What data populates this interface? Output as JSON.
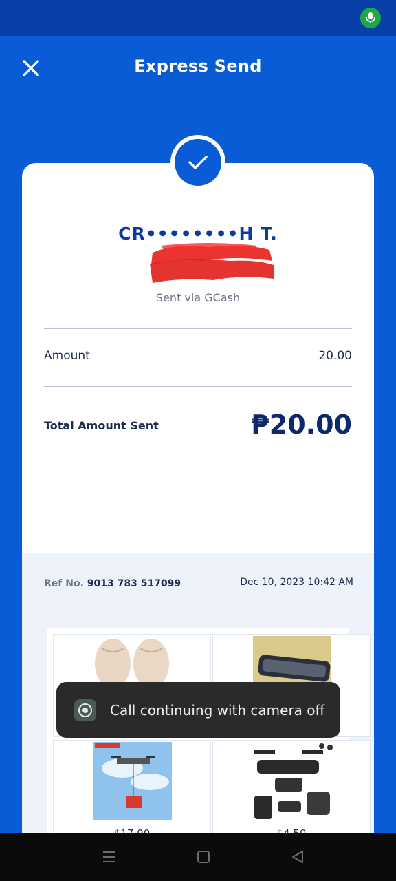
{
  "header": {
    "title": "Express Send"
  },
  "recipient": {
    "name": "CR••••••••H T.",
    "sent_via": "Sent via GCash"
  },
  "amount": {
    "label": "Amount",
    "value": "20.00"
  },
  "total": {
    "label": "Total Amount Sent",
    "value": "₱20.00"
  },
  "reference": {
    "label": "Ref No.",
    "number": "9013 783 517099",
    "datetime": "Dec 10, 2023 10:42 AM"
  },
  "ads": [
    {
      "price": ""
    },
    {
      "price": ""
    },
    {
      "price": "$17.00"
    },
    {
      "price": "$4.50"
    }
  ],
  "toast": {
    "text": "Call continuing with camera off"
  },
  "icons": {
    "close": "close-icon",
    "check": "check-icon",
    "mic": "microphone-icon",
    "camera": "camera-off-icon",
    "nav_menu": "menu-icon",
    "nav_home": "home-icon",
    "nav_back": "back-icon"
  },
  "colors": {
    "brand_blue": "#0a5bd6",
    "status_bar": "#0640a8",
    "mic_green": "#1ea84a",
    "text_navy": "#0c2a6b"
  }
}
